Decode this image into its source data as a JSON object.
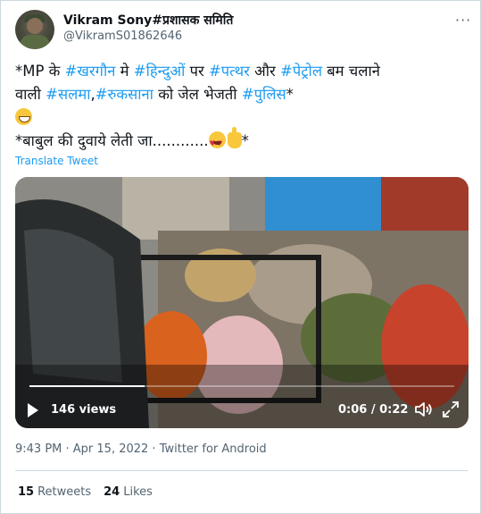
{
  "author": {
    "name": "Vikram Sony#प्रशासक समिति",
    "handle": "@VikramS01862646"
  },
  "tweet": {
    "lines": [
      [
        {
          "t": "*MP के ",
          "tag": false
        },
        {
          "t": "#खरगौन",
          "tag": true
        },
        {
          "t": " मे ",
          "tag": false
        },
        {
          "t": "#हिन्दुओं",
          "tag": true
        },
        {
          "t": " पर ",
          "tag": false
        },
        {
          "t": "#पत्थर",
          "tag": true
        },
        {
          "t": " और ",
          "tag": false
        },
        {
          "t": "#पेट्रोल",
          "tag": true
        },
        {
          "t": " बम चलाने",
          "tag": false
        }
      ],
      [
        {
          "t": "वाली ",
          "tag": false
        },
        {
          "t": "#सलमा",
          "tag": true
        },
        {
          "t": ",",
          "tag": false
        },
        {
          "t": "#रुकसाना",
          "tag": true
        },
        {
          "t": " को जेल भेजती ",
          "tag": false
        },
        {
          "t": "#पुलिस",
          "tag": true
        },
        {
          "t": "*",
          "tag": false
        }
      ]
    ],
    "line3_emoji": "grinning-face-icon",
    "line4_text": "*बाबुल की दुवाये लेती जा............",
    "line4_suffix": "*",
    "translate_label": "Translate Tweet"
  },
  "video": {
    "views": "146 views",
    "time": "0:06 / 0:22",
    "progress": 0.27
  },
  "meta": {
    "timestamp": "9:43 PM · Apr 15, 2022 · Twitter for Android"
  },
  "stats": {
    "retweets_count": "15",
    "retweets_label": "Retweets",
    "likes_count": "24",
    "likes_label": "Likes"
  },
  "colors": {
    "link": "#1d9bf0",
    "secondary": "#536471",
    "text": "#0f1419"
  }
}
